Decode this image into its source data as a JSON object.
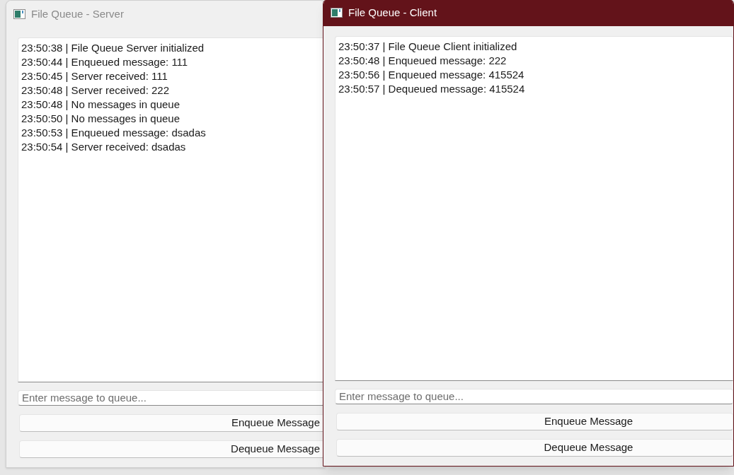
{
  "windows": [
    {
      "title": "File Queue - Server",
      "active": false,
      "log": [
        "23:50:38 | File Queue Server initialized",
        "23:50:44 | Enqueued message: 111",
        "23:50:45 | Server received: 111",
        "23:50:48 | Server received: 222",
        "23:50:48 | No messages in queue",
        "23:50:50 | No messages in queue",
        "23:50:53 | Enqueued message: dsadas",
        "23:50:54 | Server received: dsadas"
      ],
      "input": {
        "placeholder": "Enter message to queue..."
      },
      "buttons": [
        "Enqueue Message",
        "Dequeue Message"
      ]
    },
    {
      "title": "File Queue - Client",
      "active": true,
      "log": [
        "23:50:37 | File Queue Client initialized",
        "23:50:48 | Enqueued message: 222",
        "23:50:56 | Enqueued message: 415524",
        "23:50:57 | Dequeued message: 415524"
      ],
      "input": {
        "placeholder": "Enter message to queue..."
      },
      "buttons": [
        "Enqueue Message",
        "Dequeue Message"
      ]
    }
  ]
}
